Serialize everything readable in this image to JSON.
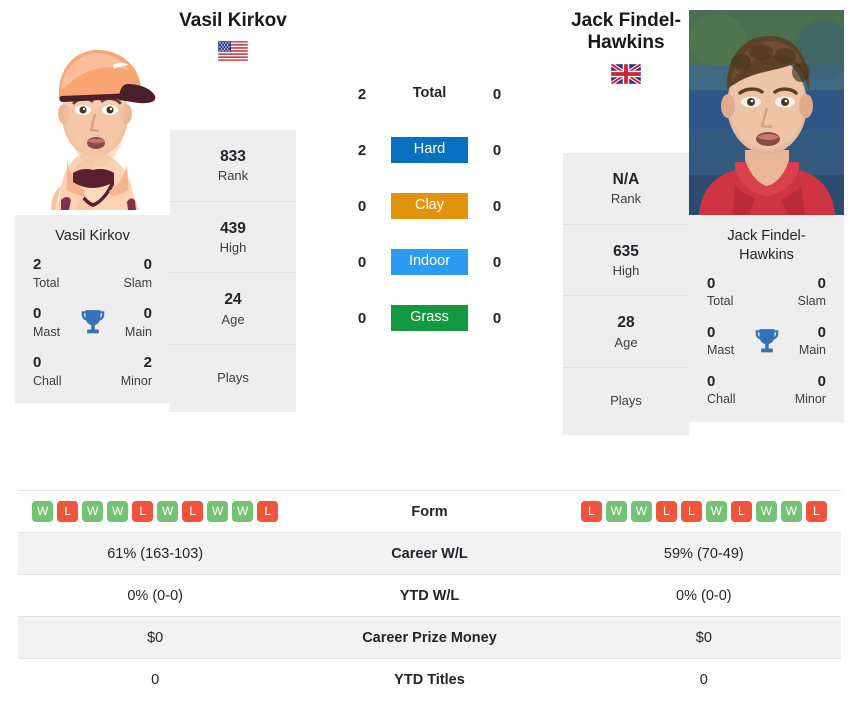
{
  "players": {
    "left": {
      "name": "Vasil Kirkov",
      "name_display": "Vasil Kirkov",
      "caption": "Vasil Kirkov",
      "flag": "us-flag-icon",
      "flag_alt": "United States",
      "titles": {
        "total": {
          "value": "2",
          "label": "Total"
        },
        "slam": {
          "value": "0",
          "label": "Slam"
        },
        "mast": {
          "value": "0",
          "label": "Mast"
        },
        "main": {
          "value": "0",
          "label": "Main"
        },
        "chall": {
          "value": "0",
          "label": "Chall"
        },
        "minor": {
          "value": "2",
          "label": "Minor"
        }
      },
      "panel": [
        {
          "value": "833",
          "label": "Rank"
        },
        {
          "value": "439",
          "label": "High"
        },
        {
          "value": "24",
          "label": "Age"
        },
        {
          "value": "",
          "label": "Plays"
        }
      ],
      "form": [
        "W",
        "L",
        "W",
        "W",
        "L",
        "W",
        "L",
        "W",
        "W",
        "L"
      ],
      "career_wl": "61% (163-103)",
      "ytd_wl": "0% (0-0)",
      "career_prize_money": "$0",
      "ytd_titles": "0"
    },
    "right": {
      "name": "Jack Findel-Hawkins",
      "name_display": "Jack Findel-\nHawkins",
      "caption": "Jack Findel-\nHawkins",
      "flag": "gb-flag-icon",
      "flag_alt": "United Kingdom",
      "titles": {
        "total": {
          "value": "0",
          "label": "Total"
        },
        "slam": {
          "value": "0",
          "label": "Slam"
        },
        "mast": {
          "value": "0",
          "label": "Mast"
        },
        "main": {
          "value": "0",
          "label": "Main"
        },
        "chall": {
          "value": "0",
          "label": "Chall"
        },
        "minor": {
          "value": "0",
          "label": "Minor"
        }
      },
      "panel": [
        {
          "value": "N/A",
          "label": "Rank"
        },
        {
          "value": "635",
          "label": "High"
        },
        {
          "value": "28",
          "label": "Age"
        },
        {
          "value": "",
          "label": "Plays"
        }
      ],
      "form": [
        "L",
        "W",
        "W",
        "L",
        "L",
        "W",
        "L",
        "W",
        "W",
        "L"
      ],
      "career_wl": "59% (70-49)",
      "ytd_wl": "0% (0-0)",
      "career_prize_money": "$0",
      "ytd_titles": "0"
    }
  },
  "surfaces": [
    {
      "label": "Total",
      "left": "2",
      "right": "0",
      "color": "",
      "style": "plain"
    },
    {
      "label": "Hard",
      "left": "2",
      "right": "0",
      "color": "#0771c0",
      "style": "badge"
    },
    {
      "label": "Clay",
      "left": "0",
      "right": "0",
      "color": "#e0930b",
      "style": "badge"
    },
    {
      "label": "Indoor",
      "left": "0",
      "right": "0",
      "color": "#2b9bf4",
      "style": "badge"
    },
    {
      "label": "Grass",
      "left": "0",
      "right": "0",
      "color": "#13993f",
      "style": "badge"
    }
  ],
  "table": {
    "rows": [
      {
        "label": "Form",
        "left": "",
        "right": "",
        "type": "form"
      },
      {
        "label": "Career W/L",
        "left": "61% (163-103)",
        "right": "59% (70-49)",
        "type": "text"
      },
      {
        "label": "YTD W/L",
        "left": "0% (0-0)",
        "right": "0% (0-0)",
        "type": "text"
      },
      {
        "label": "Career Prize Money",
        "left": "$0",
        "right": "$0",
        "type": "text"
      },
      {
        "label": "YTD Titles",
        "left": "0",
        "right": "0",
        "type": "text"
      }
    ]
  },
  "colors": {
    "hard": "#0771c0",
    "clay": "#e0930b",
    "indoor": "#2b9bf4",
    "grass": "#13993f",
    "win": "#74c276",
    "loss": "#f0553c",
    "trophy": "#3573b9",
    "panel_bg": "#eeeeee",
    "row_alt_bg": "#f2f2f2"
  }
}
